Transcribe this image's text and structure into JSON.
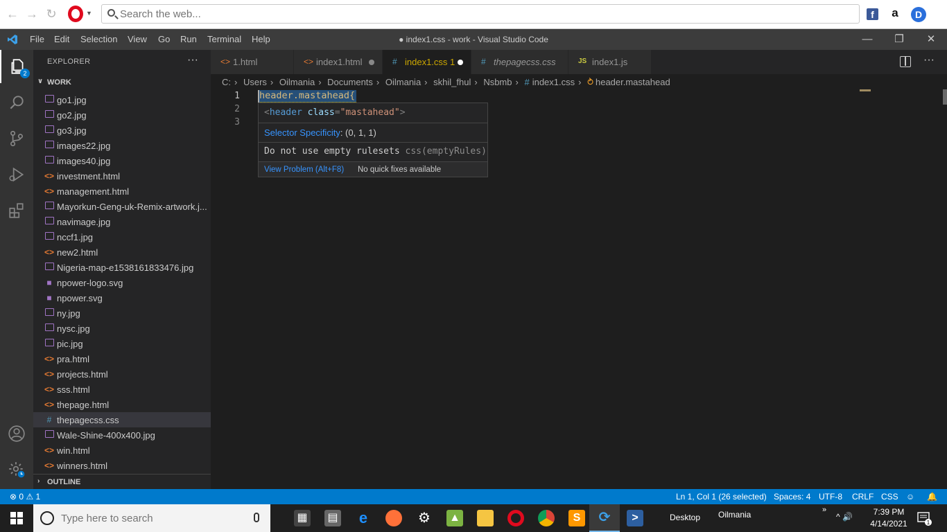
{
  "browser": {
    "search_placeholder": "Search the web...",
    "fb_label": "f",
    "amazon_label": "a",
    "d_label": "D"
  },
  "titlebar": {
    "menu": [
      "File",
      "Edit",
      "Selection",
      "View",
      "Go",
      "Run",
      "Terminal",
      "Help"
    ],
    "title": "● index1.css - work - Visual Studio Code"
  },
  "activity": {
    "badge": "2"
  },
  "sidebar": {
    "title": "EXPLORER",
    "more": "···",
    "folder": "WORK",
    "outline": "OUTLINE",
    "files": [
      {
        "name": "go1.jpg",
        "type": "img"
      },
      {
        "name": "go2.jpg",
        "type": "img"
      },
      {
        "name": "go3.jpg",
        "type": "img"
      },
      {
        "name": "images22.jpg",
        "type": "img"
      },
      {
        "name": "images40.jpg",
        "type": "img"
      },
      {
        "name": "investment.html",
        "type": "html"
      },
      {
        "name": "management.html",
        "type": "html"
      },
      {
        "name": "Mayorkun-Geng-uk-Remix-artwork.j...",
        "type": "img"
      },
      {
        "name": "navimage.jpg",
        "type": "img"
      },
      {
        "name": "nccf1.jpg",
        "type": "img"
      },
      {
        "name": "new2.html",
        "type": "html"
      },
      {
        "name": "Nigeria-map-e1538161833476.jpg",
        "type": "img"
      },
      {
        "name": "npower-logo.svg",
        "type": "svg"
      },
      {
        "name": "npower.svg",
        "type": "svg"
      },
      {
        "name": "ny.jpg",
        "type": "img"
      },
      {
        "name": "nysc.jpg",
        "type": "img"
      },
      {
        "name": "pic.jpg",
        "type": "img"
      },
      {
        "name": "pra.html",
        "type": "html"
      },
      {
        "name": "projects.html",
        "type": "html"
      },
      {
        "name": "sss.html",
        "type": "html"
      },
      {
        "name": "thepage.html",
        "type": "html"
      },
      {
        "name": "thepagecss.css",
        "type": "css",
        "active": true
      },
      {
        "name": "Wale-Shine-400x400.jpg",
        "type": "img"
      },
      {
        "name": "win.html",
        "type": "html"
      },
      {
        "name": "winners.html",
        "type": "html"
      }
    ]
  },
  "tabs": [
    {
      "label": "1.html",
      "icon": "<>",
      "type": "html"
    },
    {
      "label": "index1.html",
      "icon": "<>",
      "type": "html",
      "modified": true
    },
    {
      "label": "index1.css 1",
      "icon": "#",
      "type": "css",
      "active": true,
      "modified": true
    },
    {
      "label": "thepagecss.css",
      "icon": "#",
      "type": "css",
      "italic": true
    },
    {
      "label": "index1.js",
      "icon": "JS",
      "type": "js"
    }
  ],
  "breadcrumb": {
    "parts": [
      "C:",
      "Users",
      "Oilmania",
      "Documents",
      "Oilmania",
      "skhil_fhul",
      "Nsbmb"
    ],
    "file": "index1.css",
    "symbol": "header.mastahead"
  },
  "editor": {
    "line_numbers": [
      "1",
      "2",
      "3"
    ],
    "line1": "header.mastahead{"
  },
  "hover": {
    "preview_tag": "header",
    "preview_attr": "class",
    "preview_value": "\"mastahead\"",
    "specificity_link": "Selector Specificity",
    "specificity_value": ": (0, 1, 1)",
    "problem": "Do not use empty rulesets ",
    "problem_source": "css(emptyRules)",
    "view_problem": "View Problem (Alt+F8)",
    "no_fix": "No quick fixes available"
  },
  "statusbar": {
    "errors": "0",
    "warnings": "1",
    "position": "Ln 1, Col 1 (26 selected)",
    "spaces": "Spaces: 4",
    "encoding": "UTF-8",
    "eol": "CRLF",
    "language": "CSS"
  },
  "taskbar": {
    "search_placeholder": "Type here to search",
    "desktop": "Desktop",
    "user": "Oilmania",
    "expand": "»",
    "tray": "^ 🔊",
    "time": "7:39 PM",
    "date": "4/14/2021",
    "notif_count": "1"
  },
  "colors": {
    "accent": "#007acc",
    "editor_bg": "#1e1e1e",
    "sidebar_bg": "#252526",
    "activity_bg": "#333333",
    "titlebar_bg": "#3c3c3c",
    "selector_color": "#d7ba7d",
    "link_color": "#3794ff"
  }
}
